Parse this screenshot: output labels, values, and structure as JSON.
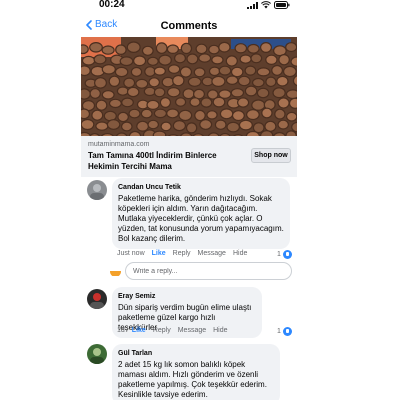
{
  "status_bar": {
    "time": "00:24"
  },
  "nav": {
    "back_label": "Back",
    "title": "Comments"
  },
  "link_card": {
    "domain": "mutaminmama.com",
    "title": "Tam Tamına 400tl İndirim Binlerce Hekimin Tercihi Mama",
    "button_label": "Shop now"
  },
  "comments": [
    {
      "name": "Candan Uncu Tetik",
      "text": "Paketleme harika, gönderim hızlıydı. Sokak köpekleri için aldım. Yarın dağıtacağım. Mutlaka yiyeceklerdir, çünkü çok açlar. O yüzden, tat konusunda yorum yapamıyacagım. Bol kazanç dilerim.",
      "time": "Just now",
      "like": "Like",
      "reply": "Reply",
      "message": "Message",
      "hide": "Hide",
      "reactions": "1"
    },
    {
      "name": "Eray Semiz",
      "text": "Dün sipariş verdim bugün elime ulaştı paketleme güzel kargo hızlı teşekkürler",
      "time": "1d",
      "like": "Like",
      "reply": "Reply",
      "message": "Message",
      "hide": "Hide",
      "reactions": "1"
    },
    {
      "name": "Gül Tarlan",
      "text": "2 adet 15 kg lık somon balıklı köpek maması aldım. Hızlı gönderim ve özenli paketleme yapılmış. Çok teşekkür ederim. Kesinlikle tavsiye ederim."
    }
  ],
  "reply_box": {
    "placeholder": "Write a reply..."
  },
  "colors": {
    "accent": "#2d88ff",
    "bubble": "#f0f2f5",
    "secondary_text": "#65676b"
  }
}
